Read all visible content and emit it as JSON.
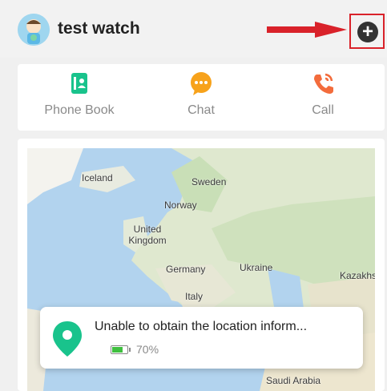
{
  "header": {
    "device_name": "test watch"
  },
  "actions": [
    {
      "label": "Phone Book",
      "icon": "phone-book-icon",
      "color": "#19c38c"
    },
    {
      "label": "Chat",
      "icon": "chat-icon",
      "color": "#f7a21b"
    },
    {
      "label": "Call",
      "icon": "call-icon",
      "color": "#f36c3c"
    }
  ],
  "map": {
    "labels": [
      "Iceland",
      "Sweden",
      "Norway",
      "United Kingdom",
      "Germany",
      "Ukraine",
      "Kazakhs",
      "Italy",
      "Saudi Arabia"
    ]
  },
  "location": {
    "status": "Unable to obtain the location inform...",
    "battery_text": "70%",
    "battery_level": 0.7
  },
  "colors": {
    "annotation_red": "#d9222a",
    "pin_green": "#19c38c"
  }
}
